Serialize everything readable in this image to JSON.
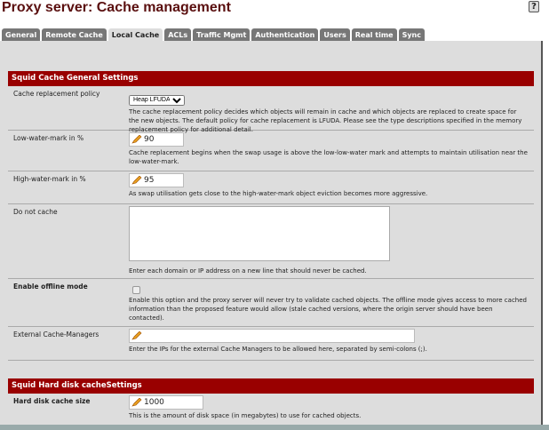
{
  "title": "Proxy server: Cache management",
  "help_icon": "?",
  "tabs": [
    "General",
    "Remote Cache",
    "Local Cache",
    "ACLs",
    "Traffic Mgmt",
    "Authentication",
    "Users",
    "Real time",
    "Sync"
  ],
  "active_tab": "Local Cache",
  "section1": {
    "title": "Squid Cache General Settings",
    "policy": {
      "label": "Cache replacement policy",
      "value": "Heap LFUDA",
      "desc": "The cache replacement policy decides which objects will remain in cache and which objects are replaced to create space for the new objects. The default policy for cache replacement is LFUDA. Please see the type descriptions specified in the memory replacement policy for additional detail."
    },
    "low": {
      "label": "Low-water-mark in %",
      "value": "90",
      "desc": "Cache replacement begins when the swap usage is above the low-low-water mark and attempts to maintain utilisation near the low-water-mark."
    },
    "high": {
      "label": "High-water-mark in %",
      "value": "95",
      "desc": "As swap utilisation gets close to the high-water-mark object eviction becomes more aggressive."
    },
    "nocache": {
      "label": "Do not cache",
      "value": "",
      "desc": "Enter each domain or IP address on a new line that should never be cached."
    },
    "offline": {
      "label": "Enable offline mode",
      "checked": false,
      "desc": "Enable this option and the proxy server will never try to validate cached objects. The offline mode gives access to more cached information than the proposed feature would allow (stale cached versions, where the origin server should have been contacted)."
    },
    "managers": {
      "label": "External Cache-Managers",
      "value": "",
      "desc": "Enter the IPs for the external Cache Managers to be allowed here, separated by semi-colons (;)."
    }
  },
  "section2": {
    "title": "Squid Hard disk cacheSettings",
    "size": {
      "label": "Hard disk cache size",
      "value": "1000",
      "desc": "This is the amount of disk space (in megabytes) to use for cached objects."
    }
  }
}
